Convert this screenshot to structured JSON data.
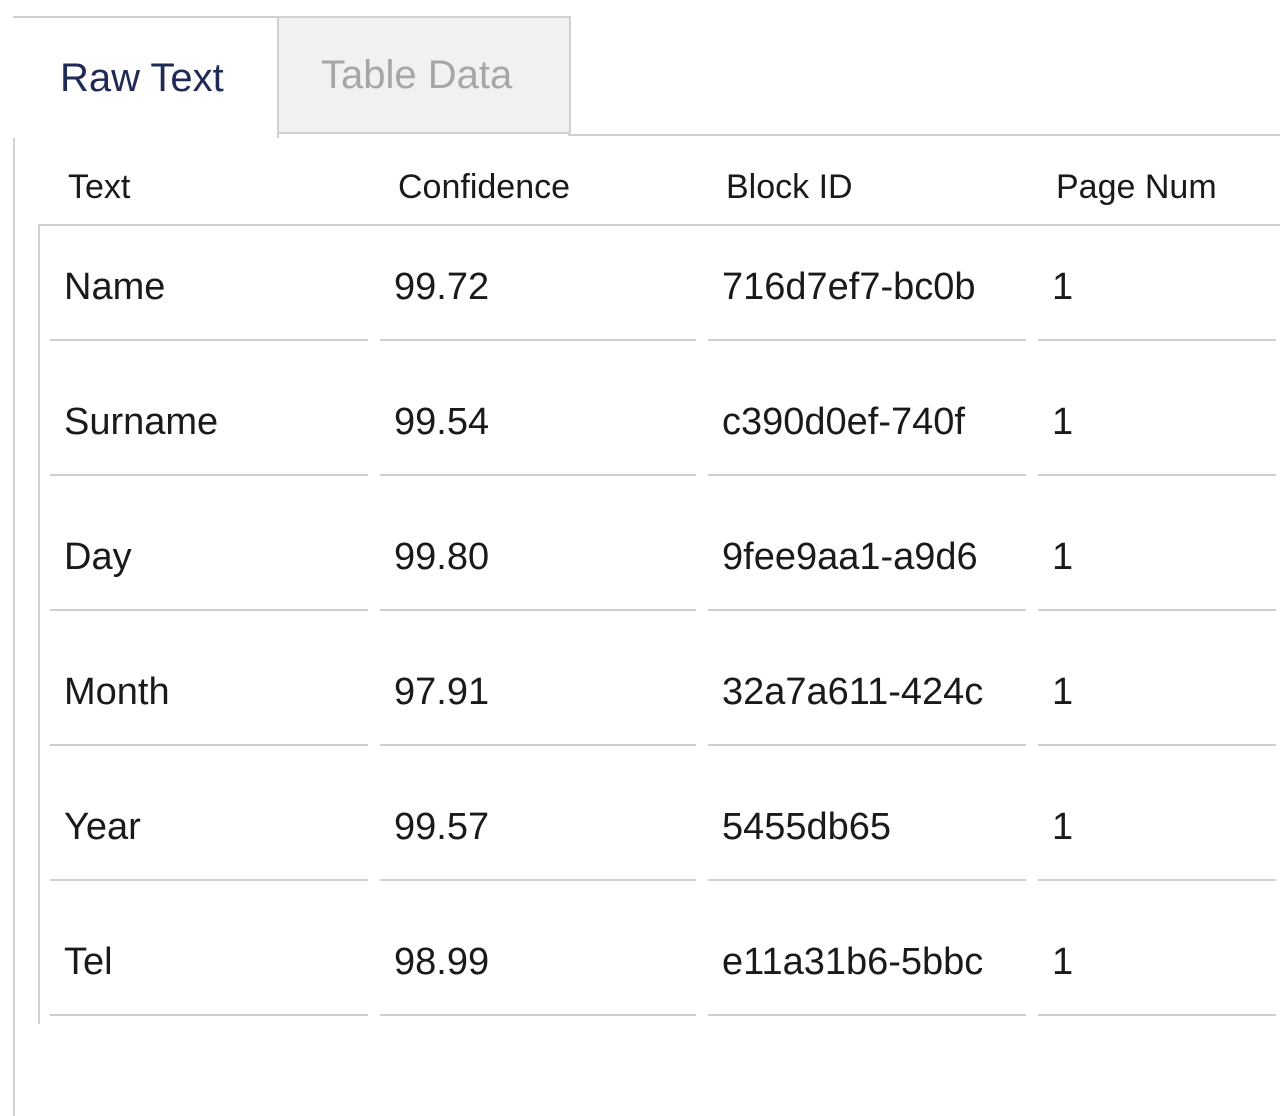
{
  "tabs": [
    {
      "label": "Raw Text",
      "active": true
    },
    {
      "label": "Table Data",
      "active": false
    }
  ],
  "table": {
    "headers": [
      "Text",
      "Confidence",
      "Block ID",
      "Page Num"
    ],
    "rows": [
      [
        "Name",
        "99.72",
        "716d7ef7-bc0b",
        "1"
      ],
      [
        "Surname",
        "99.54",
        "c390d0ef-740f",
        "1"
      ],
      [
        "Day",
        "99.80",
        "9fee9aa1-a9d6",
        "1"
      ],
      [
        "Month",
        "97.91",
        "32a7a611-424c",
        "1"
      ],
      [
        "Year",
        "99.57",
        "5455db65",
        "1"
      ],
      [
        "Tel",
        "98.99",
        "e11a31b6-5bbc",
        "1"
      ]
    ]
  }
}
